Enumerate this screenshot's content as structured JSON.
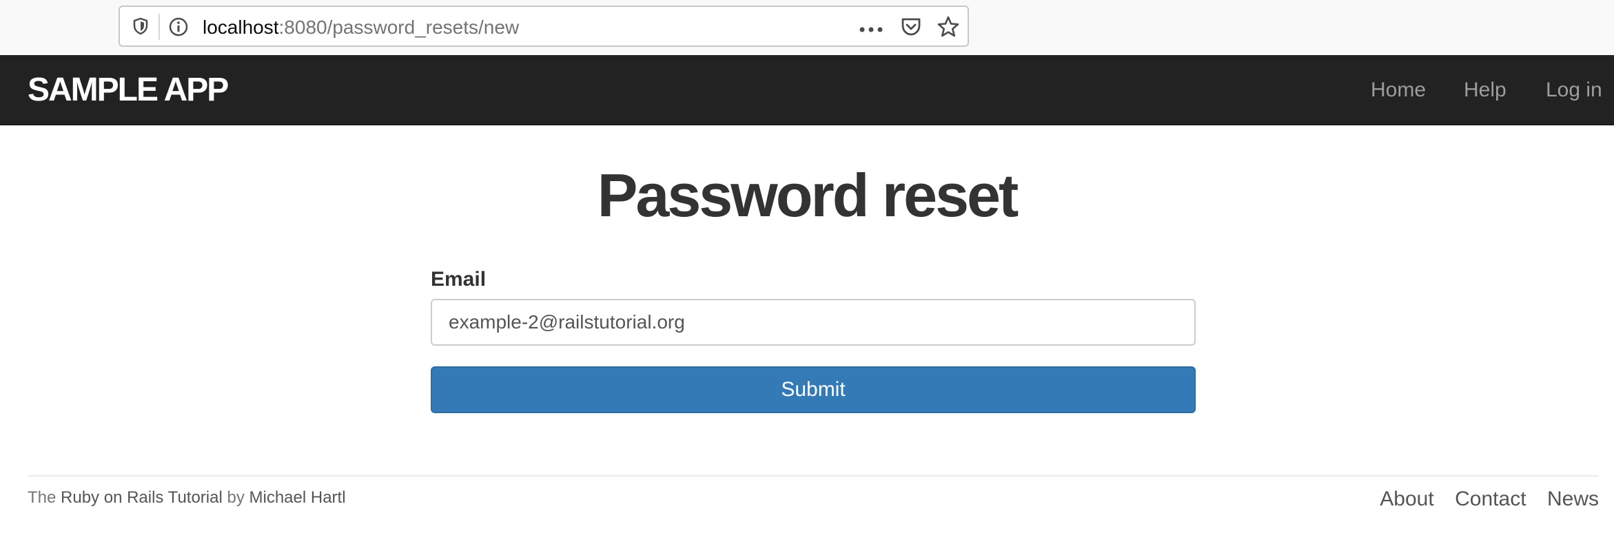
{
  "browser": {
    "url_host": "localhost",
    "url_path": ":8080/password_resets/new"
  },
  "header": {
    "logo": "sample app",
    "nav": {
      "home": "Home",
      "help": "Help",
      "login": "Log in"
    }
  },
  "main": {
    "title": "Password reset",
    "form": {
      "email_label": "Email",
      "email_value": "example-2@railstutorial.org",
      "submit_label": "Submit"
    }
  },
  "footer": {
    "prefix": "The ",
    "tutorial_link": "Ruby on Rails Tutorial",
    "middle": " by ",
    "author_link": "Michael Hartl",
    "links": {
      "about": "About",
      "contact": "Contact",
      "news": "News"
    }
  },
  "colors": {
    "header_bg": "#222222",
    "primary_button": "#337ab7",
    "nav_link": "#9d9d9d"
  },
  "icons": [
    "shield-icon",
    "info-icon",
    "more-icon",
    "pocket-icon",
    "star-icon"
  ]
}
